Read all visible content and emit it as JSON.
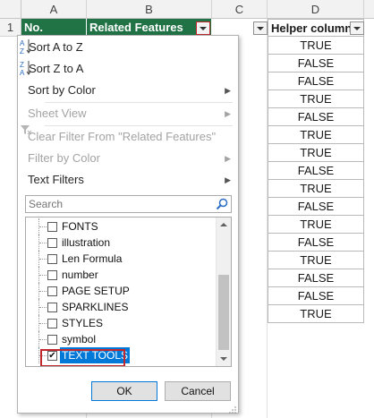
{
  "columns": [
    "A",
    "B",
    "C",
    "D"
  ],
  "row_number": "1",
  "headers": {
    "a": "No.",
    "b": "Related Features",
    "d": "Helper column"
  },
  "helper_values": [
    "TRUE",
    "FALSE",
    "FALSE",
    "TRUE",
    "FALSE",
    "TRUE",
    "TRUE",
    "FALSE",
    "TRUE",
    "FALSE",
    "TRUE",
    "FALSE",
    "TRUE",
    "FALSE",
    "FALSE",
    "TRUE"
  ],
  "menu": {
    "sort_az": "Sort A to Z",
    "sort_za": "Sort Z to A",
    "sort_color": "Sort by Color",
    "sheet_view": "Sheet View",
    "clear_filter": "Clear Filter From \"Related Features\"",
    "filter_color": "Filter by Color",
    "text_filters": "Text Filters"
  },
  "search": {
    "placeholder": "Search"
  },
  "filter_list": [
    {
      "label": "FONTS",
      "checked": false
    },
    {
      "label": "illustration",
      "checked": false
    },
    {
      "label": "Len Formula",
      "checked": false
    },
    {
      "label": "number",
      "checked": false
    },
    {
      "label": "PAGE SETUP",
      "checked": false
    },
    {
      "label": "SPARKLINES",
      "checked": false
    },
    {
      "label": "STYLES",
      "checked": false
    },
    {
      "label": "symbol",
      "checked": false
    },
    {
      "label": "TEXT TOOLS",
      "checked": true
    }
  ],
  "buttons": {
    "ok": "OK",
    "cancel": "Cancel"
  },
  "colors": {
    "header_green": "#217346",
    "highlight": "#c0282d",
    "selection": "#0078d7"
  }
}
